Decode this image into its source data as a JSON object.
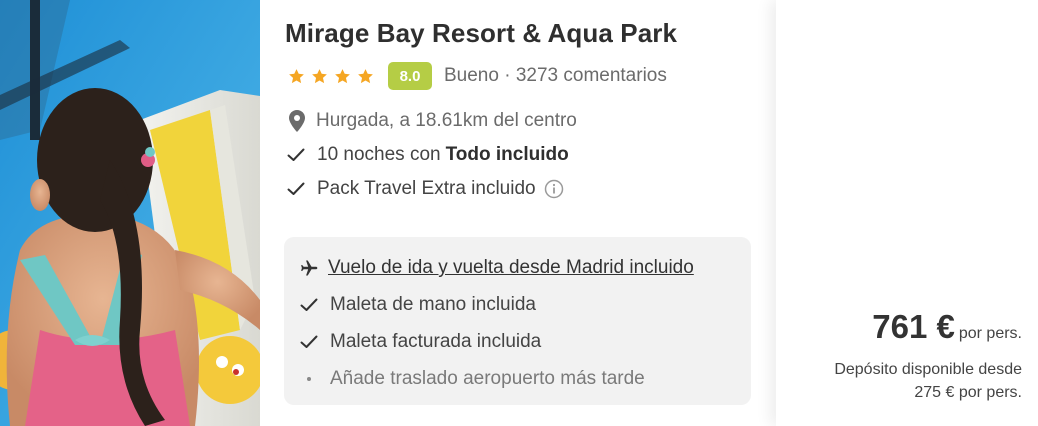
{
  "hotel": {
    "name": "Mirage Bay Resort & Aqua Park",
    "stars": 4,
    "score": "8.0",
    "score_color": "#b5cd45",
    "star_color": "#f5a623",
    "rating_text": "Bueno · 3273 comentarios",
    "location": "Hurgada, a 18.61km del centro"
  },
  "features": {
    "nights_prefix": "10 noches con",
    "nights_bold": "Todo incluido",
    "pack": "Pack Travel Extra incluido"
  },
  "flight_box": {
    "flight_link": "Vuelo de ida y vuelta desde Madrid incluido",
    "hand_luggage": "Maleta de mano incluida",
    "checked_luggage": "Maleta facturada incluida",
    "transfer": "Añade traslado aeropuerto más tarde"
  },
  "pricing": {
    "price": "761 €",
    "per_person": "por pers.",
    "deposit_line1": "Depósito disponible desde",
    "deposit_line2": "275 € por pers."
  },
  "icons": [
    "star-icon",
    "location-pin-icon",
    "check-icon",
    "info-icon",
    "plane-icon",
    "bullet-dot-icon"
  ]
}
